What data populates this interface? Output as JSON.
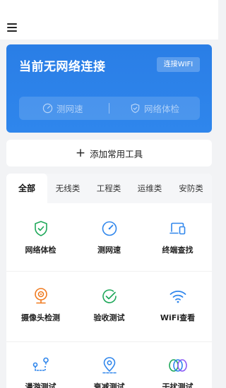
{
  "header": {
    "menu_icon": "hamburger-menu-icon"
  },
  "network_card": {
    "title": "当前无网络连接",
    "connect_wifi_label": "连接WIFI",
    "speed_test_label": "测网速",
    "network_check_label": "网络体检",
    "accent_color": "#2f86ec"
  },
  "add_tool": {
    "label": "添加常用工具"
  },
  "tabs": [
    {
      "label": "全部",
      "active": true
    },
    {
      "label": "无线类",
      "active": false
    },
    {
      "label": "工程类",
      "active": false
    },
    {
      "label": "运维类",
      "active": false
    },
    {
      "label": "安防类",
      "active": false
    }
  ],
  "tools": [
    {
      "label": "网络体检",
      "icon": "shield-check-icon",
      "color": "#1fa85a"
    },
    {
      "label": "测网速",
      "icon": "speedometer-icon",
      "color": "#2f86ec"
    },
    {
      "label": "终端查找",
      "icon": "devices-icon",
      "color": "#2f86ec"
    },
    {
      "label": "摄像头检测",
      "icon": "camera-icon",
      "color": "#f07a1f"
    },
    {
      "label": "验收测试",
      "icon": "check-circle-icon",
      "color": "#1fa85a"
    },
    {
      "label": "WiFi查看",
      "icon": "wifi-icon",
      "color": "#2f86ec"
    },
    {
      "label": "漫游测试",
      "icon": "roaming-route-icon",
      "color": "#2f86ec"
    },
    {
      "label": "衰减测试",
      "icon": "location-pin-icon",
      "color": "#2f86ec"
    },
    {
      "label": "干扰测试",
      "icon": "interference-rings-icon",
      "color": "#8b5cf6"
    }
  ]
}
